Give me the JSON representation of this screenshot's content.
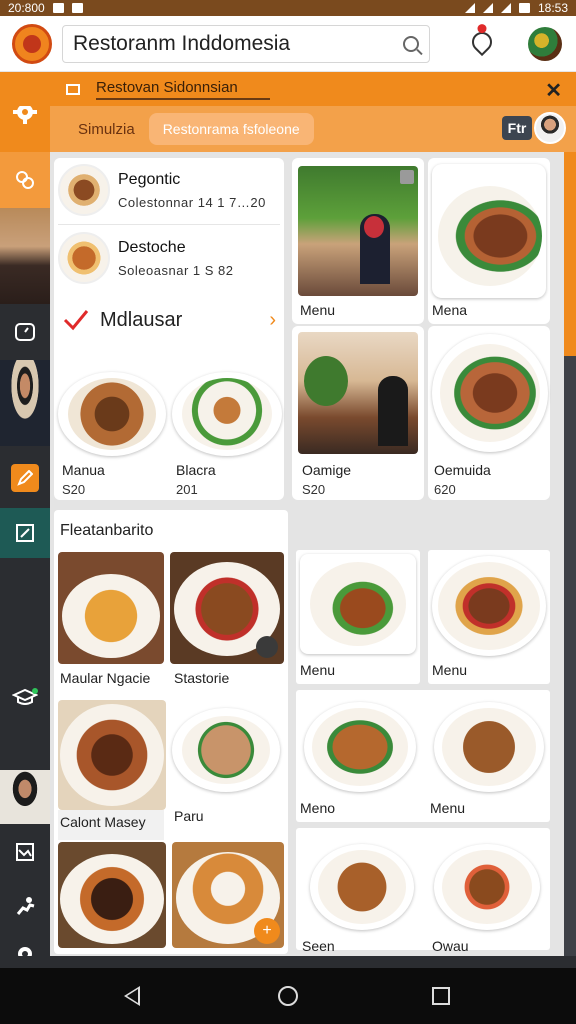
{
  "status": {
    "time": "20:800",
    "clock": "18:53"
  },
  "app": {
    "search_value": "Restoranm Inddomesia"
  },
  "header": {
    "title": "Restovan Sidonnsian"
  },
  "subheader": {
    "chip1": "Simulzia",
    "chip2": "Restonrama fsfoleone",
    "badge": "Ftr"
  },
  "featured_list": [
    {
      "title": "Pegontic",
      "subtitle": "Colestonnar 14 1 7…20"
    },
    {
      "title": "Destoche",
      "subtitle": "Soleoasnar 1 S 82"
    }
  ],
  "category_link": {
    "label": "Mdlausar"
  },
  "left_cards": [
    {
      "name": "Manua",
      "price": "S20"
    },
    {
      "name": "Blacra",
      "price": "201"
    }
  ],
  "right_cards": [
    {
      "name": "Menu"
    },
    {
      "name": "Mena"
    },
    {
      "name": "Oamige",
      "price": "S20"
    },
    {
      "name": "Oemuida",
      "price": "620"
    }
  ],
  "section": {
    "title": "Fleatanbarito"
  },
  "grid_left": [
    {
      "name": "Maular Ngacie"
    },
    {
      "name": "Stastorie"
    },
    {
      "name": "Calont Masey"
    },
    {
      "name": "Paru"
    }
  ],
  "grid_right": [
    {
      "name": "Menu"
    },
    {
      "name": "Menu"
    },
    {
      "name": "Meno"
    },
    {
      "name": "Menu"
    },
    {
      "name": "Seen"
    },
    {
      "name": "Owau"
    }
  ],
  "colors": {
    "accent": "#f08a1c",
    "accent_light": "#f3a14a",
    "sidebar": "#2b2d31",
    "active_tab": "#f08a1c"
  },
  "icons": [
    "settings-icon",
    "link-icon",
    "clock-icon",
    "edit-icon",
    "note-icon",
    "graduation-icon",
    "chart-icon",
    "runner-icon",
    "location-icon"
  ]
}
